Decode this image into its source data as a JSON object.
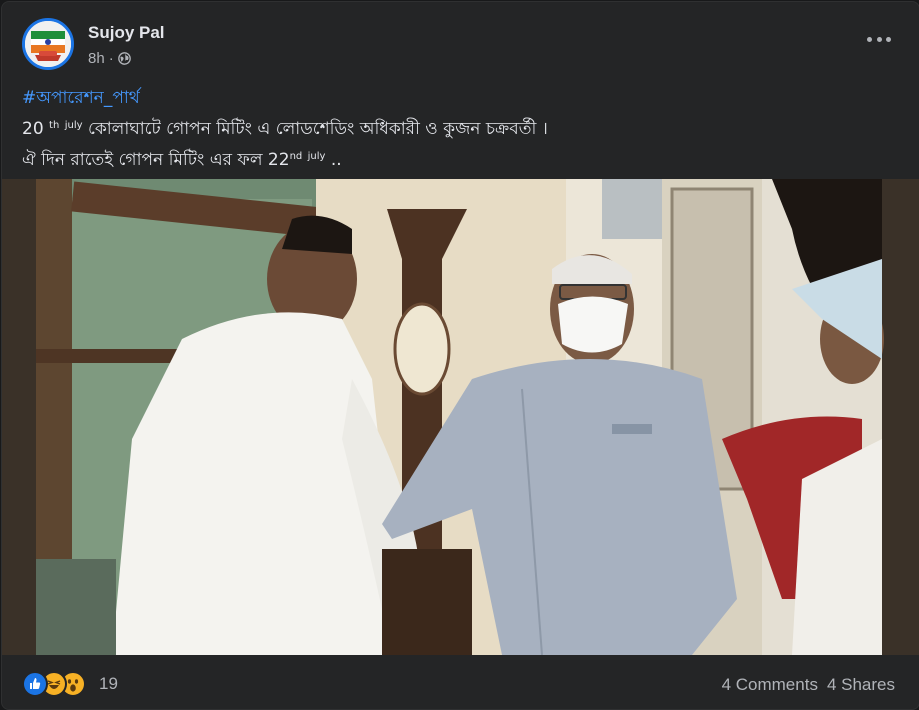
{
  "post": {
    "author": "Sujoy Pal",
    "time": "8h",
    "separator": "·",
    "hashtag": "#অপারেশন_পার্থ",
    "line1": {
      "num": "20",
      "sup1": "th",
      "sup2": "july",
      "text": "কোলাঘাটে গোপন মিটিং এ লোডশেডিং অধিকারী ও কুজন চক্রবর্তী ।"
    },
    "line2": {
      "text": "ঐ দিন রাতেই গোপন মিটিং এর ফল 22",
      "sup1": "nd",
      "sup2": "july",
      "tail": ".."
    }
  },
  "footer": {
    "reactions": [
      "like-icon",
      "haha-icon",
      "wow-icon"
    ],
    "reaction_count": "19",
    "comments": "4 Comments",
    "shares": "4 Shares"
  },
  "colors": {
    "background": "#242526",
    "text": "#e4e6eb",
    "secondary": "#b0b3b8",
    "hashtag": "#4599ff",
    "like_blue": "#1b74e4",
    "emoji_yellow": "#f7b125"
  }
}
